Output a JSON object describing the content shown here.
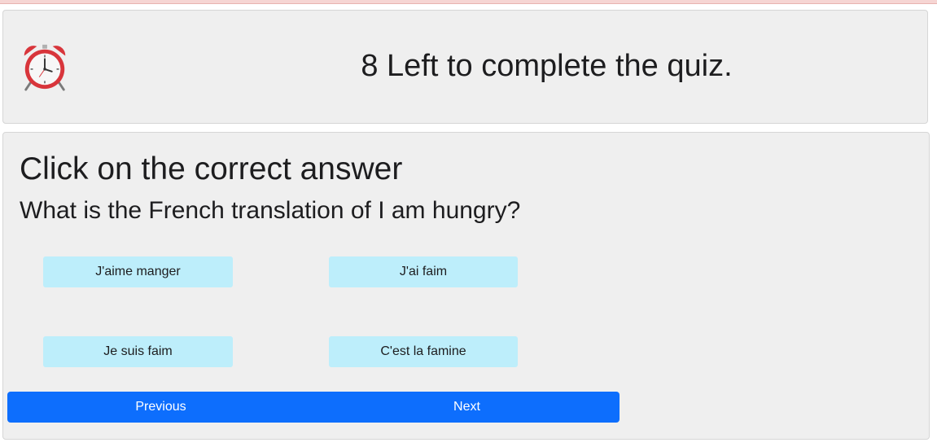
{
  "timer": {
    "icon": "alarm-clock-icon",
    "text": "8 Left to complete the quiz."
  },
  "quiz": {
    "instruction": "Click on the correct answer",
    "question": "What is the French translation of I am hungry?",
    "answers": [
      "J'aime manger",
      "J'ai faim",
      "Je suis faim",
      "C'est la famine"
    ]
  },
  "navigation": {
    "previous_label": "Previous",
    "next_label": "Next"
  },
  "colors": {
    "answer_bg": "#bdeefb",
    "primary": "#0d6efd",
    "card_bg": "#efefef"
  }
}
